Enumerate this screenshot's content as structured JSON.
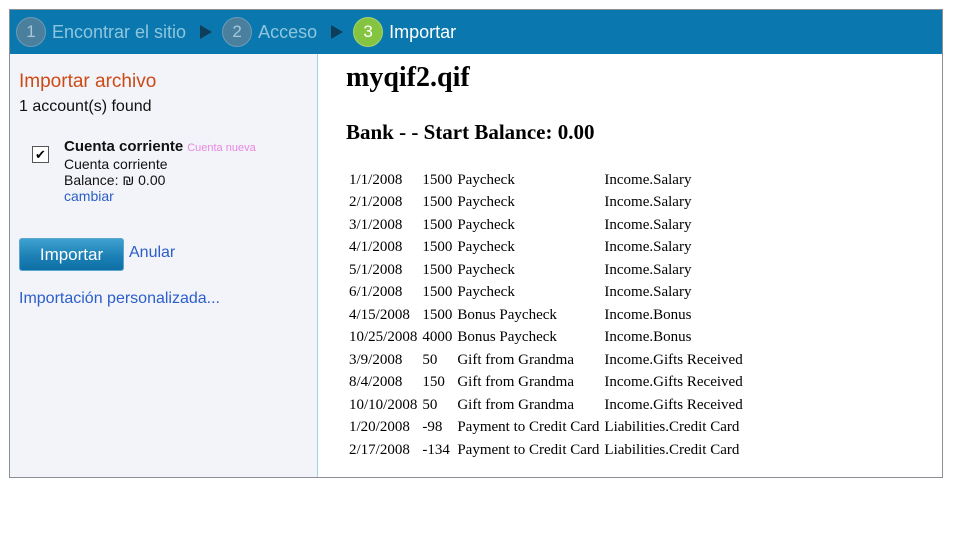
{
  "steps": [
    {
      "num": "1",
      "label": "Encontrar el sitio"
    },
    {
      "num": "2",
      "label": "Acceso"
    },
    {
      "num": "3",
      "label": "Importar"
    }
  ],
  "sidebar": {
    "title": "Importar archivo",
    "found": "1 account(s) found",
    "account": {
      "name": "Cuenta corriente",
      "badge": "Cuenta nueva",
      "type": "Cuenta corriente",
      "balance": "Balance: ₪ 0.00",
      "change": "cambiar",
      "checked": true
    },
    "import_button": "Importar",
    "cancel": "Anular",
    "custom": "Importación personalizada..."
  },
  "main": {
    "filename": "myqif2.qif",
    "bank_header": "Bank - - Start Balance: 0.00",
    "transactions": [
      [
        "1/1/2008",
        "1500",
        "Paycheck",
        "Income.Salary"
      ],
      [
        "2/1/2008",
        "1500",
        "Paycheck",
        "Income.Salary"
      ],
      [
        "3/1/2008",
        "1500",
        "Paycheck",
        "Income.Salary"
      ],
      [
        "4/1/2008",
        "1500",
        "Paycheck",
        "Income.Salary"
      ],
      [
        "5/1/2008",
        "1500",
        "Paycheck",
        "Income.Salary"
      ],
      [
        "6/1/2008",
        "1500",
        "Paycheck",
        "Income.Salary"
      ],
      [
        "4/15/2008",
        "1500",
        "Bonus Paycheck",
        "Income.Bonus"
      ],
      [
        "10/25/2008",
        "4000",
        "Bonus Paycheck",
        "Income.Bonus"
      ],
      [
        "3/9/2008",
        "50",
        "Gift from Grandma",
        "Income.Gifts Received"
      ],
      [
        "8/4/2008",
        "150",
        "Gift from Grandma",
        "Income.Gifts Received"
      ],
      [
        "10/10/2008",
        "50",
        "Gift from Grandma",
        "Income.Gifts Received"
      ],
      [
        "1/20/2008",
        "-98",
        "Payment to Credit Card",
        "Liabilities.Credit Card"
      ],
      [
        "2/17/2008",
        "-134",
        "Payment to Credit Card",
        "Liabilities.Credit Card"
      ]
    ]
  }
}
